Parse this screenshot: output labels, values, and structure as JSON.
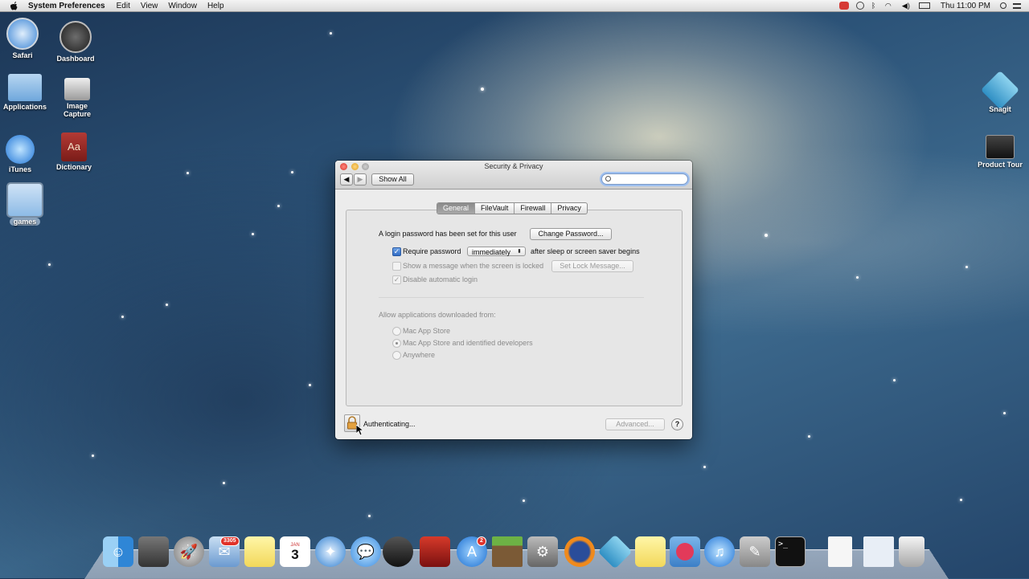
{
  "menubar": {
    "app_name": "System Preferences",
    "items": [
      "Edit",
      "View",
      "Window",
      "Help"
    ],
    "clock": "Thu 11:00 PM"
  },
  "desktop": {
    "icons": {
      "safari": "Safari",
      "dashboard": "Dashboard",
      "applications": "Applications",
      "image_capture": "Image\nCapture",
      "itunes": "iTunes",
      "dictionary": "Dictionary",
      "games": "games",
      "snagit": "Snagit",
      "product_tour": "Product Tour"
    }
  },
  "window": {
    "title": "Security & Privacy",
    "show_all": "Show All",
    "search_placeholder": "",
    "tabs": [
      "General",
      "FileVault",
      "Firewall",
      "Privacy"
    ],
    "selected_tab": "General",
    "login_password_text": "A login password has been set for this user",
    "change_password_button": "Change Password...",
    "require_password_label": "Require password",
    "require_password_checked": true,
    "require_password_value": "immediately",
    "after_sleep_text": "after sleep or screen saver begins",
    "show_message_label": "Show a message when the screen is locked",
    "show_message_checked": false,
    "set_lock_message_button": "Set Lock Message...",
    "disable_auto_login_label": "Disable automatic login",
    "disable_auto_login_checked": true,
    "allow_apps_heading": "Allow applications downloaded from:",
    "allow_options": [
      "Mac App Store",
      "Mac App Store and identified developers",
      "Anywhere"
    ],
    "allow_selected": "Mac App Store and identified developers",
    "authenticating_text": "Authenticating...",
    "advanced_button": "Advanced...",
    "help_button": "?"
  },
  "dock": {
    "mail_badge": "3305",
    "app_store_badge": "2",
    "calendar_day": "3",
    "calendar_month": "JAN"
  }
}
